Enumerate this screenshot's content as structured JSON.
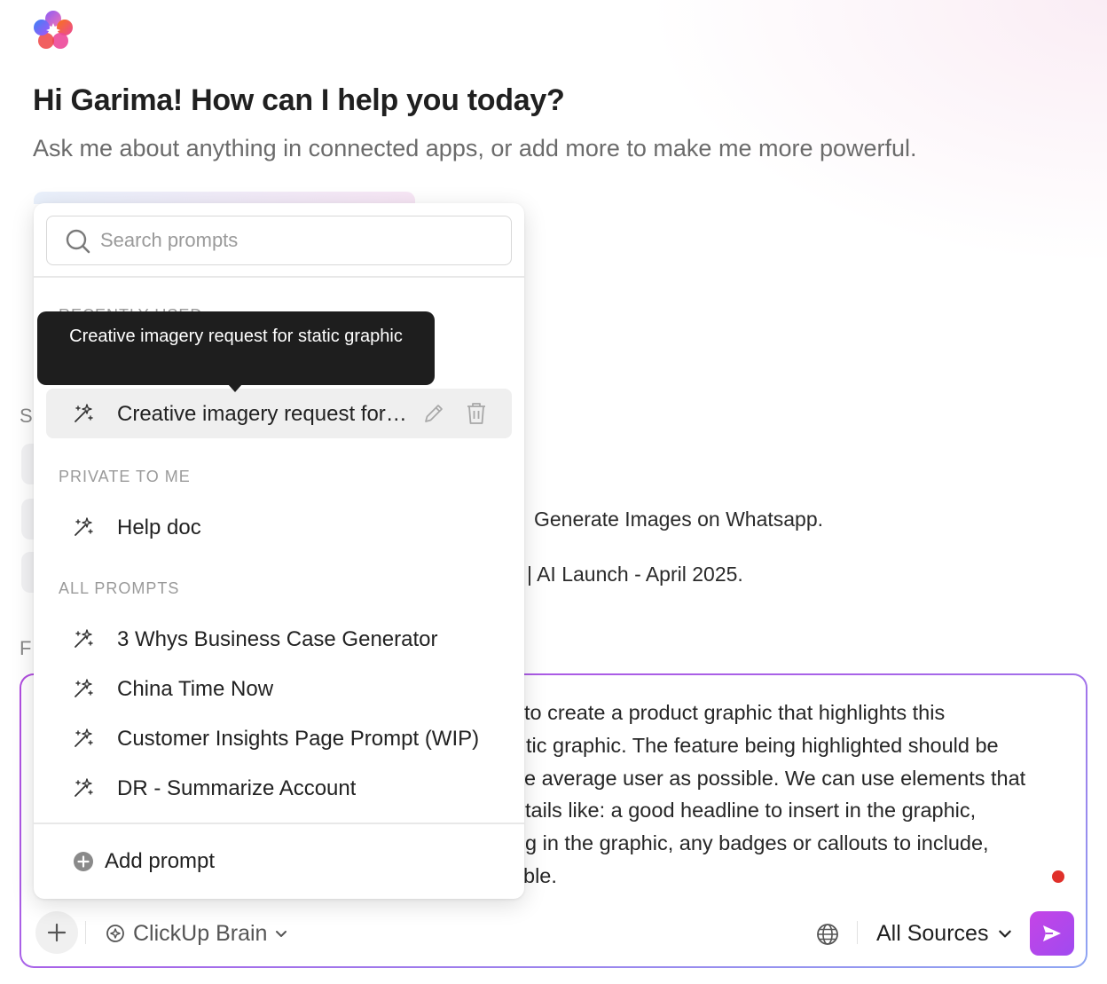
{
  "header": {
    "greeting": "Hi Garima! How can I help you today?",
    "subtitle": "Ask me about anything in connected apps, or add more to make me more powerful."
  },
  "background": {
    "fragment_s": "S",
    "fragment_f": "F",
    "suggestion_1": "Generate Images on Whatsapp.",
    "suggestion_2": "| AI Launch - April 2025."
  },
  "composer": {
    "text_lines": [
      "to create a product graphic that highlights this",
      "tic graphic. The feature being highlighted should be",
      "e average user as possible. We can use elements that",
      "tails like: a good headline to insert in the graphic,",
      "g in the graphic, any badges or callouts to include,",
      "ble."
    ],
    "model_label": "ClickUp Brain",
    "sources_label": "All Sources",
    "record_indicator_color": "#e0302a"
  },
  "prompts_dropdown": {
    "search_placeholder": "Search prompts",
    "recently_used_label": "RECENTLY USED",
    "recently_used": [
      {
        "label": "Creative imagery request for static graphic",
        "icon": "prompt-sparkle-icon"
      }
    ],
    "tooltip": "Creative imagery request for static graphic",
    "private_label": "PRIVATE TO ME",
    "private": [
      {
        "label": "Help doc",
        "icon": "prompt-sparkle-icon"
      }
    ],
    "all_label": "ALL PROMPTS",
    "all": [
      {
        "label": "3 Whys Business Case Generator",
        "icon": "prompt-sparkle-icon"
      },
      {
        "label": "China Time Now",
        "icon": "prompt-sparkle-icon"
      },
      {
        "label": "Customer Insights Page Prompt (WIP)",
        "icon": "prompt-sparkle-icon"
      },
      {
        "label": "DR - Summarize Account",
        "icon": "prompt-sparkle-icon"
      }
    ],
    "add_label": "Add prompt"
  },
  "colors": {
    "accent": "#b14de0",
    "send_button": "#c544e6",
    "tooltip_bg": "#1e1e1e"
  }
}
